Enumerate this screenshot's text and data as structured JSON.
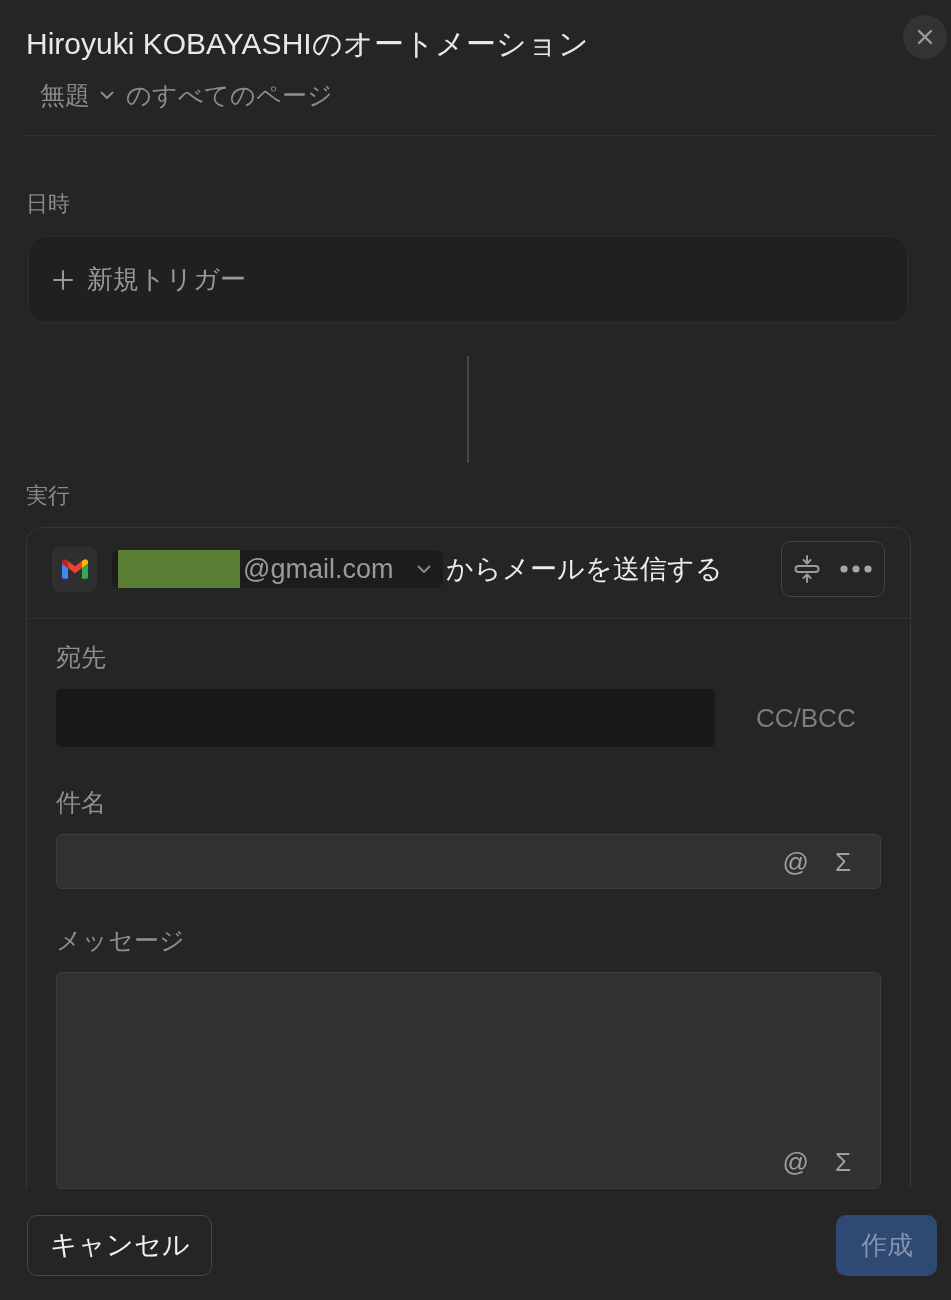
{
  "dialog": {
    "title": "Hiroyuki KOBAYASHIのオートメーション",
    "scope": {
      "database": "無題",
      "pages": "のすべてのページ"
    }
  },
  "trigger_section": {
    "label": "日時",
    "add_trigger": "新規トリガー"
  },
  "action_section": {
    "label": "実行",
    "action": {
      "account": "@gmail.com",
      "description": "からメールを送信する",
      "fields": [
        {
          "kind": "recipients",
          "label": "宛先",
          "option": "CC/BCC"
        },
        {
          "kind": "subject",
          "label": "件名",
          "tools": [
            "@",
            "Σ"
          ]
        },
        {
          "kind": "message",
          "label": "メッセージ",
          "tools": [
            "@",
            "Σ"
          ]
        }
      ]
    }
  },
  "footer": {
    "buttons": [
      {
        "label": "キャンセル",
        "kind": "secondary",
        "disabled": false
      },
      {
        "label": "作成",
        "kind": "primary",
        "disabled": true
      }
    ]
  }
}
